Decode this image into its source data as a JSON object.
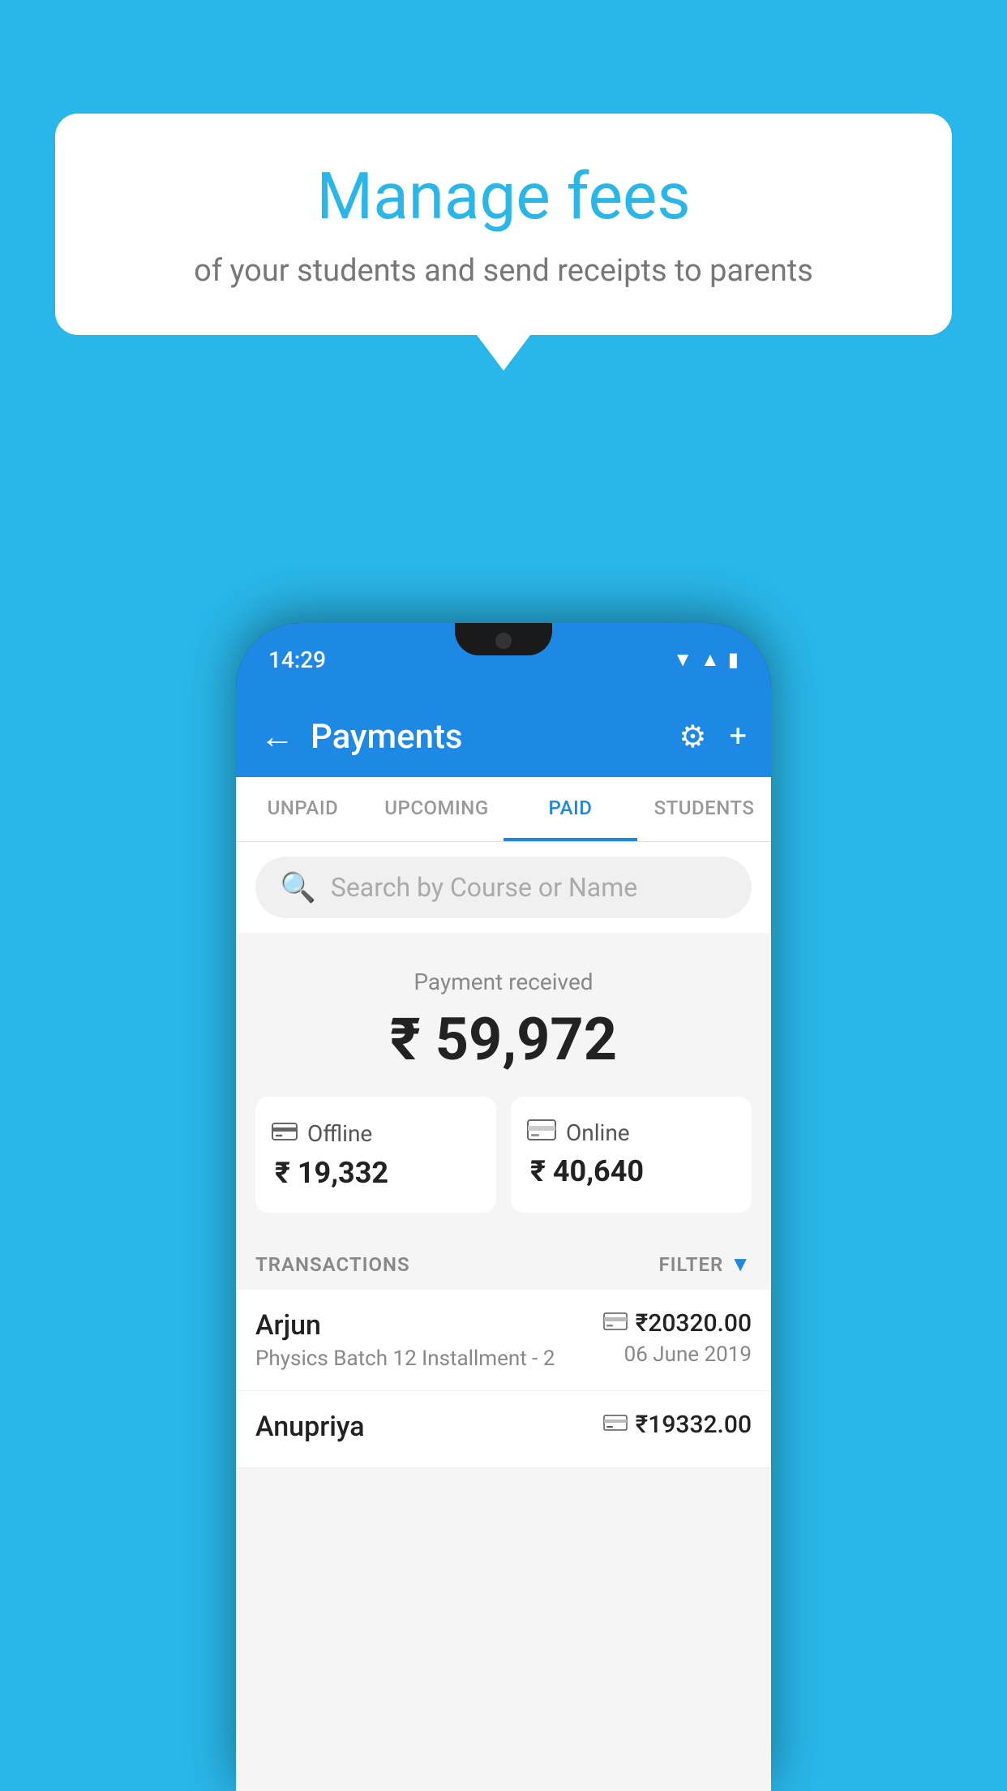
{
  "background_color": "#29b6e8",
  "bubble": {
    "title": "Manage fees",
    "subtitle": "of your students and send receipts to parents"
  },
  "phone": {
    "status_time": "14:29",
    "header": {
      "title": "Payments",
      "back_label": "←",
      "settings_icon": "⚙",
      "add_icon": "+"
    },
    "tabs": [
      {
        "label": "UNPAID",
        "active": false
      },
      {
        "label": "UPCOMING",
        "active": false
      },
      {
        "label": "PAID",
        "active": true
      },
      {
        "label": "STUDENTS",
        "active": false
      }
    ],
    "search": {
      "placeholder": "Search by Course or Name"
    },
    "payment_summary": {
      "label": "Payment received",
      "total": "₹ 59,972",
      "offline_label": "Offline",
      "offline_amount": "₹ 19,332",
      "online_label": "Online",
      "online_amount": "₹ 40,640"
    },
    "transactions_section": {
      "label": "TRANSACTIONS",
      "filter_label": "FILTER"
    },
    "transactions": [
      {
        "name": "Arjun",
        "desc": "Physics Batch 12 Installment - 2",
        "amount": "₹20320.00",
        "date": "06 June 2019",
        "payment_type": "card"
      },
      {
        "name": "Anupriya",
        "desc": "",
        "amount": "₹19332.00",
        "date": "",
        "payment_type": "offline"
      }
    ]
  }
}
